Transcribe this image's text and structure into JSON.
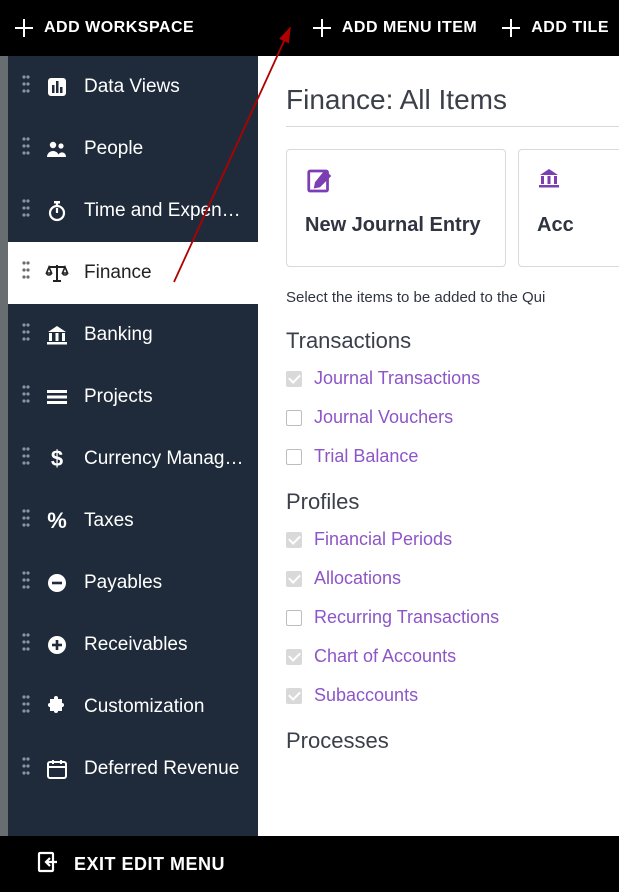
{
  "topbar": {
    "add_workspace": "ADD WORKSPACE",
    "add_menu_item": "ADD MENU ITEM",
    "add_tile": "ADD TILE"
  },
  "sidebar": {
    "items": [
      {
        "label": "Data Views",
        "icon": "chart"
      },
      {
        "label": "People",
        "icon": "people"
      },
      {
        "label": "Time and Expenses",
        "icon": "stopwatch"
      },
      {
        "label": "Finance",
        "icon": "scales"
      },
      {
        "label": "Banking",
        "icon": "bank"
      },
      {
        "label": "Projects",
        "icon": "projects"
      },
      {
        "label": "Currency Manage...",
        "icon": "dollar"
      },
      {
        "label": "Taxes",
        "icon": "percent"
      },
      {
        "label": "Payables",
        "icon": "minus-circle"
      },
      {
        "label": "Receivables",
        "icon": "plus-circle"
      },
      {
        "label": "Customization",
        "icon": "puzzle"
      },
      {
        "label": "Deferred Revenue",
        "icon": "calendar"
      }
    ],
    "active_index": 3
  },
  "main": {
    "title": "Finance: All Items",
    "tiles": [
      {
        "label": "New Journal Entry",
        "icon": "edit"
      },
      {
        "label": "Acc",
        "icon": "bank"
      }
    ],
    "instruction": "Select the items to be added to the Qui",
    "sections": [
      {
        "header": "Transactions",
        "items": [
          {
            "label": "Journal Transactions",
            "checked": true
          },
          {
            "label": "Journal Vouchers",
            "checked": false
          },
          {
            "label": "Trial Balance",
            "checked": false
          }
        ]
      },
      {
        "header": "Profiles",
        "items": [
          {
            "label": "Financial Periods",
            "checked": true
          },
          {
            "label": "Allocations",
            "checked": true
          },
          {
            "label": "Recurring Transactions",
            "checked": false
          },
          {
            "label": "Chart of Accounts",
            "checked": true
          },
          {
            "label": "Subaccounts",
            "checked": true
          }
        ]
      },
      {
        "header": "Processes",
        "items": []
      }
    ]
  },
  "bottombar": {
    "exit_label": "EXIT EDIT MENU"
  }
}
